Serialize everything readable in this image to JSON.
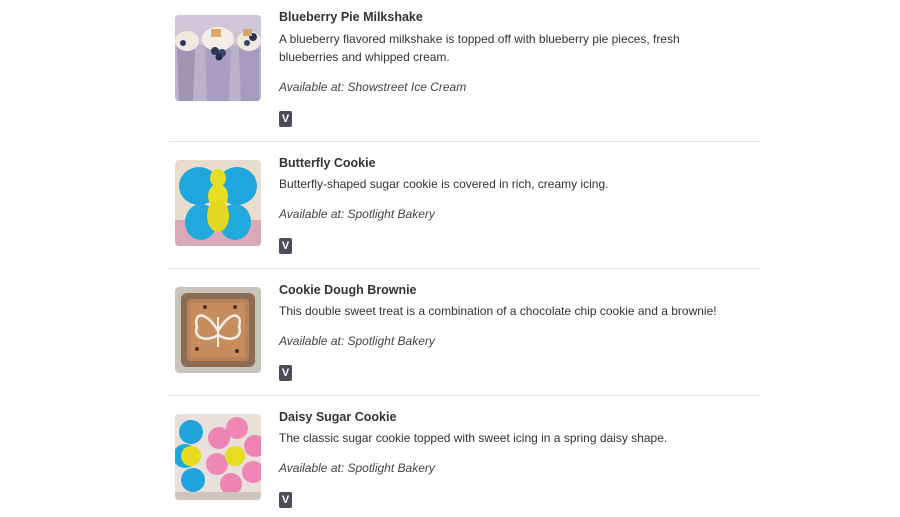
{
  "items": [
    {
      "title": "Blueberry Pie Milkshake",
      "description": "A blueberry flavored milkshake is topped off with blueberry pie pieces, fresh blueberries and whipped cream.",
      "availability": "Available at: Showstreet Ice Cream",
      "badge": "V"
    },
    {
      "title": "Butterfly Cookie",
      "description": "Butterfly-shaped sugar cookie is covered in rich, creamy icing.",
      "availability": "Available at: Spotlight Bakery",
      "badge": "V"
    },
    {
      "title": "Cookie Dough Brownie",
      "description": "This double sweet treat is a combination of a chocolate chip cookie and a brownie!",
      "availability": "Available at: Spotlight Bakery",
      "badge": "V"
    },
    {
      "title": "Daisy Sugar Cookie",
      "description": "The classic sugar cookie topped with sweet icing in a spring daisy shape.",
      "availability": "Available at: Spotlight Bakery",
      "badge": "V"
    }
  ]
}
